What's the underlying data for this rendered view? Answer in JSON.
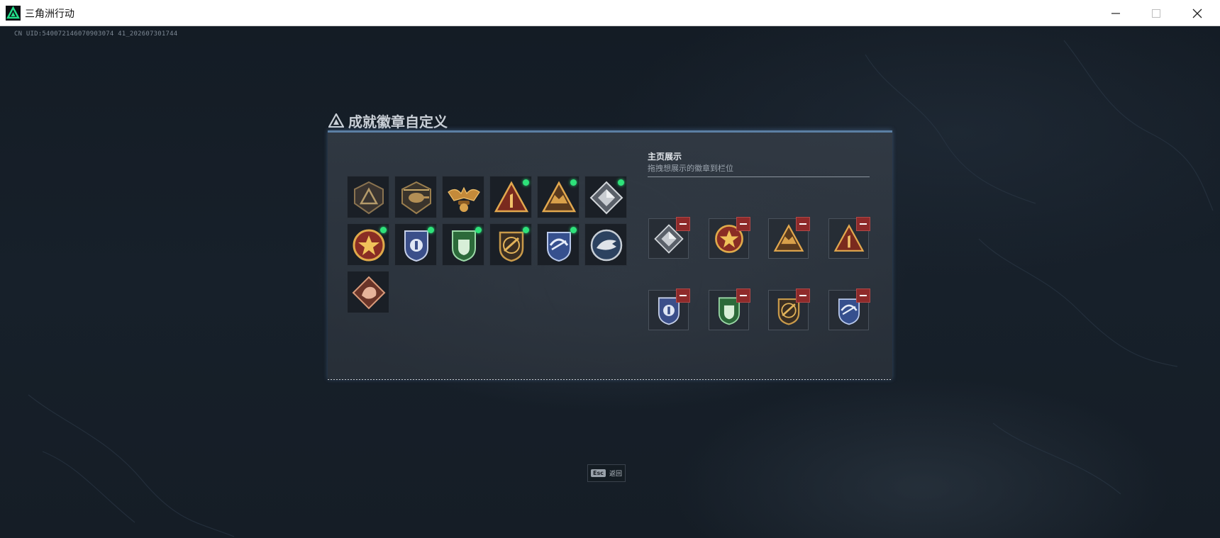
{
  "window": {
    "title": "三角洲行动",
    "minimize_icon": "minimize-icon",
    "maximize_icon": "maximize-icon",
    "close_icon": "close-icon"
  },
  "uid_text": "CN UID:540072146070903074 41_202607301744",
  "panel": {
    "title": "成就徽章自定义",
    "header_icon": "delta-logo-icon",
    "accent_color": "#5b7fa3",
    "new_indicator_color": "#2ee27a",
    "remove_button_color": "#8e2a2a"
  },
  "badge_grid": [
    {
      "icon": "triangle-shield-badge",
      "new": false
    },
    {
      "icon": "helicopter-badge",
      "new": false
    },
    {
      "icon": "winged-emblem-badge",
      "new": false
    },
    {
      "icon": "number-one-triangle-badge",
      "new": true
    },
    {
      "icon": "eagle-triangle-badge",
      "new": true
    },
    {
      "icon": "silver-diamond-badge",
      "new": true
    },
    {
      "icon": "star-medal-badge",
      "new": true
    },
    {
      "icon": "blue-police-shield-badge",
      "new": true
    },
    {
      "icon": "green-shield-badge",
      "new": true
    },
    {
      "icon": "gold-crest-badge",
      "new": true
    },
    {
      "icon": "blue-laurel-shield-badge",
      "new": true
    },
    {
      "icon": "eagle-head-medal-badge",
      "new": false
    },
    {
      "icon": "dragon-diamond-badge",
      "new": false
    }
  ],
  "homepage_display": {
    "title": "主页展示",
    "subtitle": "拖拽想展示的徽章到栏位",
    "slots": [
      {
        "icon": "silver-diamond-badge",
        "remove_icon": "remove-icon"
      },
      {
        "icon": "star-medal-badge",
        "remove_icon": "remove-icon"
      },
      {
        "icon": "eagle-triangle-badge",
        "remove_icon": "remove-icon"
      },
      {
        "icon": "number-one-triangle-badge",
        "remove_icon": "remove-icon"
      },
      {
        "icon": "blue-police-shield-badge",
        "remove_icon": "remove-icon"
      },
      {
        "icon": "green-shield-badge",
        "remove_icon": "remove-icon"
      },
      {
        "icon": "gold-crest-badge",
        "remove_icon": "remove-icon"
      },
      {
        "icon": "blue-laurel-shield-badge",
        "remove_icon": "remove-icon"
      }
    ]
  },
  "footer": {
    "esc_key": "Esc",
    "esc_label": "返回"
  }
}
